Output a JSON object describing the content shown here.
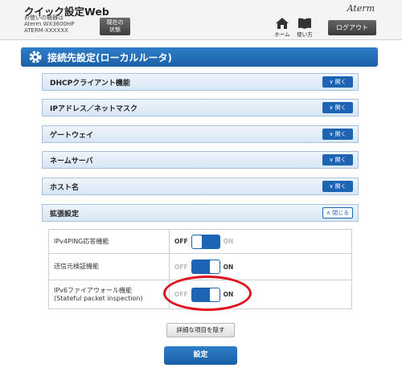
{
  "header": {
    "app_title": "クイック設定Web",
    "device_label": "お使いの機器は",
    "device_model": "Aterm WX3600HP",
    "device_id": "ATERM-XXXXXX",
    "status_button": "現在の\n状態",
    "brand": "Aterm",
    "home_label": "ホーム",
    "help_label": "使い方",
    "logout_label": "ログアウト"
  },
  "section": {
    "title": "接続先設定(ローカルルータ)"
  },
  "accordions": [
    {
      "label": "DHCPクライアント機能",
      "button": "開く",
      "state": "collapsed"
    },
    {
      "label": "IPアドレス／ネットマスク",
      "button": "開く",
      "state": "collapsed"
    },
    {
      "label": "ゲートウェイ",
      "button": "開く",
      "state": "collapsed"
    },
    {
      "label": "ネームサーバ",
      "button": "開く",
      "state": "collapsed"
    },
    {
      "label": "ホスト名",
      "button": "開く",
      "state": "collapsed"
    },
    {
      "label": "拡張設定",
      "button": "閉じる",
      "state": "expanded"
    }
  ],
  "extended_settings": [
    {
      "label": "IPv4PING応答機能",
      "off_label": "OFF",
      "on_label": "ON",
      "value": "OFF"
    },
    {
      "label": "送信元検証機能",
      "off_label": "OFF",
      "on_label": "ON",
      "value": "ON"
    },
    {
      "label_line1": "IPv6ファイアウォール機能",
      "label_line2": "(Stateful packet inspection)",
      "off_label": "OFF",
      "on_label": "ON",
      "value": "ON"
    }
  ],
  "buttons": {
    "hide_details": "詳細な項目を隠す",
    "submit": "設定"
  },
  "colors": {
    "accent_blue": "#1e64b4",
    "highlight_red": "#e0121b"
  }
}
